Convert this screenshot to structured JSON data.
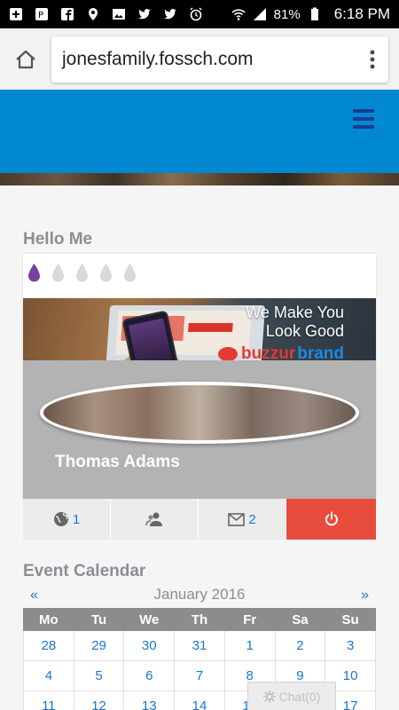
{
  "status_bar": {
    "battery": "81%",
    "time": "6:18 PM"
  },
  "browser": {
    "url": "jonesfamily.fossch.com"
  },
  "widget": {
    "title": "Hello Me",
    "drops_filled": 1,
    "drops_total": 5,
    "banner_tagline_line1": "We Make You",
    "banner_tagline_line2": "Look Good",
    "banner_brand_part1": "buzzur",
    "banner_brand_part2": "brand",
    "profile_name": "Thomas Adams",
    "actions": {
      "globe_count": "1",
      "mail_count": "2"
    }
  },
  "calendar": {
    "title": "Event Calendar",
    "prev": "«",
    "next": "»",
    "month": "January 2016",
    "weekdays": [
      "Mo",
      "Tu",
      "We",
      "Th",
      "Fr",
      "Sa",
      "Su"
    ],
    "weeks": [
      [
        "28",
        "29",
        "30",
        "31",
        "1",
        "2",
        "3"
      ],
      [
        "4",
        "5",
        "6",
        "7",
        "8",
        "9",
        "10"
      ],
      [
        "11",
        "12",
        "13",
        "14",
        "15",
        "16",
        "17"
      ]
    ]
  },
  "chat": {
    "label": "Chat(0)"
  },
  "colors": {
    "header_blue": "#0288d1",
    "link_blue": "#1976d2",
    "power_red": "#e74c3c",
    "drop_purple": "#7b3fa0"
  }
}
